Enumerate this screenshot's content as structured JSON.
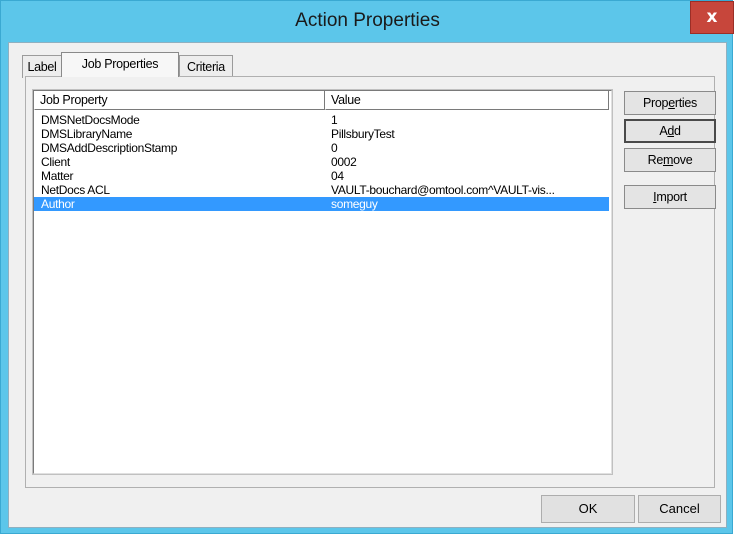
{
  "window": {
    "title": "Action Properties",
    "close_glyph": "x"
  },
  "tabs": [
    {
      "label": "Label",
      "active": false
    },
    {
      "label": "Job Properties",
      "active": true
    },
    {
      "label": "Criteria",
      "active": false
    }
  ],
  "list": {
    "columns": [
      "Job Property",
      "Value"
    ],
    "rows": [
      {
        "property": "DMSNetDocsMode",
        "value": "1"
      },
      {
        "property": "DMSLibraryName",
        "value": "PillsburyTest"
      },
      {
        "property": "DMSAddDescriptionStamp",
        "value": "0"
      },
      {
        "property": "Client",
        "value": "0002"
      },
      {
        "property": "Matter",
        "value": "04"
      },
      {
        "property": "NetDocs ACL",
        "value": "VAULT-bouchard@omtool.com^VAULT-vis..."
      },
      {
        "property": "Author",
        "value": "someguy",
        "selected": true
      }
    ]
  },
  "side_buttons": {
    "properties": {
      "pre": "Prop",
      "ul": "e",
      "post": "rties"
    },
    "add": {
      "pre": "A",
      "ul": "d",
      "post": "d"
    },
    "remove": {
      "pre": "Re",
      "ul": "m",
      "post": "ove"
    },
    "import": {
      "pre": "",
      "ul": "I",
      "post": "mport"
    }
  },
  "dialog_buttons": {
    "ok": "OK",
    "cancel": "Cancel"
  },
  "colors": {
    "titlebar": "#5cc6ea",
    "close": "#c7463b",
    "selection": "#3399ff"
  }
}
